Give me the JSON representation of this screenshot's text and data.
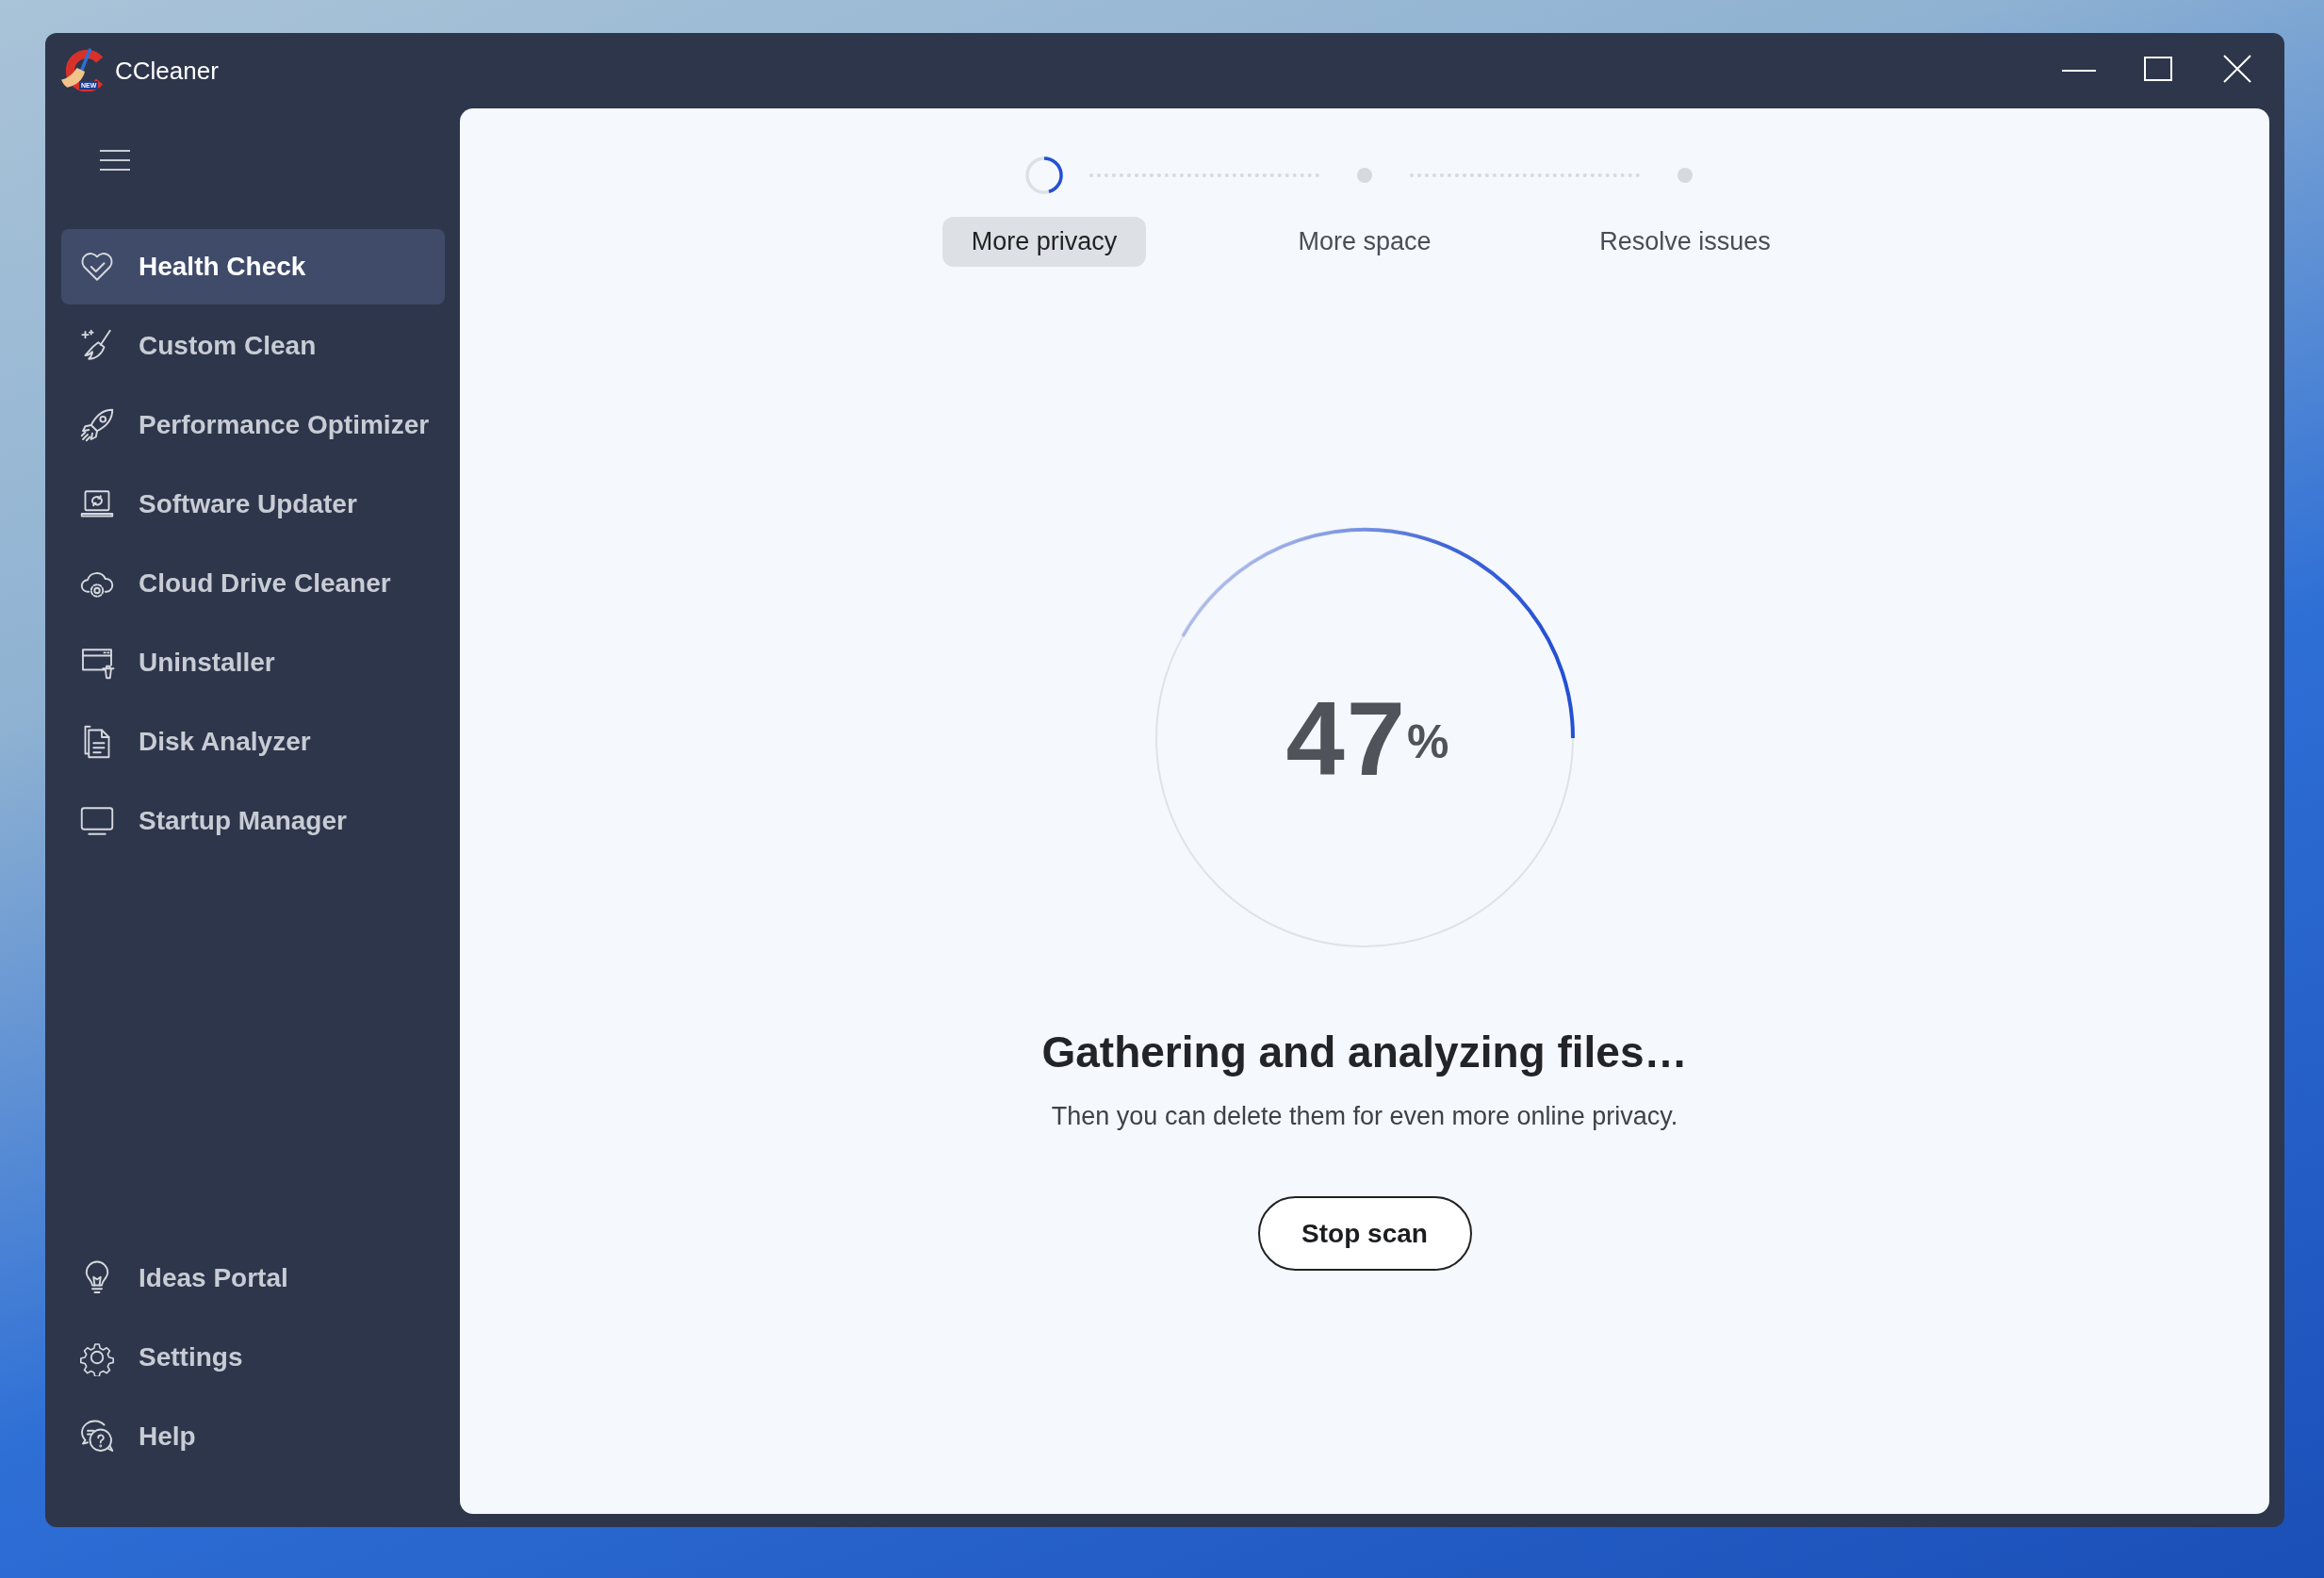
{
  "window": {
    "title": "CCleaner",
    "logo_badge": "NEW"
  },
  "sidebar": {
    "items": [
      {
        "label": "Health Check",
        "selected": true
      },
      {
        "label": "Custom Clean",
        "selected": false
      },
      {
        "label": "Performance Optimizer",
        "selected": false
      },
      {
        "label": "Software Updater",
        "selected": false
      },
      {
        "label": "Cloud Drive Cleaner",
        "selected": false
      },
      {
        "label": "Uninstaller",
        "selected": false
      },
      {
        "label": "Disk Analyzer",
        "selected": false
      },
      {
        "label": "Startup Manager",
        "selected": false
      }
    ],
    "footer_items": [
      {
        "label": "Ideas Portal",
        "selected": false
      },
      {
        "label": "Settings",
        "selected": false
      },
      {
        "label": "Help",
        "selected": false
      }
    ]
  },
  "scan": {
    "steps": [
      {
        "label": "More privacy",
        "selected": true,
        "kind": "spinner"
      },
      {
        "label": "More space",
        "selected": false,
        "kind": "dot"
      },
      {
        "label": "Resolve issues",
        "selected": false,
        "kind": "dot"
      }
    ],
    "percent": "47",
    "percent_sign": "%",
    "heading": "Gathering and analyzing files…",
    "message": "Then you can delete them for even more online privacy.",
    "stop_button": "Stop scan"
  }
}
